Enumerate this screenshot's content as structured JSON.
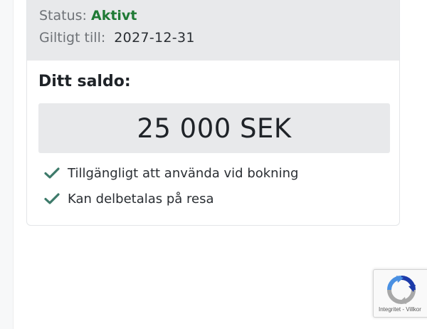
{
  "card": {
    "status_label": "Status:",
    "status_value": "Aktivt",
    "valid_label": "Giltigt till:",
    "valid_value": "2027-12-31",
    "balance_title": "Ditt saldo:",
    "balance_amount": "25 000 SEK",
    "features": [
      {
        "icon": "check-icon",
        "text": "Tillgängligt att använda vid bokning"
      },
      {
        "icon": "check-icon",
        "text": "Kan delbetalas på resa"
      }
    ]
  },
  "recaptcha": {
    "icon": "recaptcha-logo",
    "links_text": "Integritet - Villkor"
  },
  "colors": {
    "header_bg": "#e8e9eb",
    "status_green": "#1f7a35",
    "check_green": "#3d7a6a",
    "balance_box_bg": "#e8e9eb"
  }
}
